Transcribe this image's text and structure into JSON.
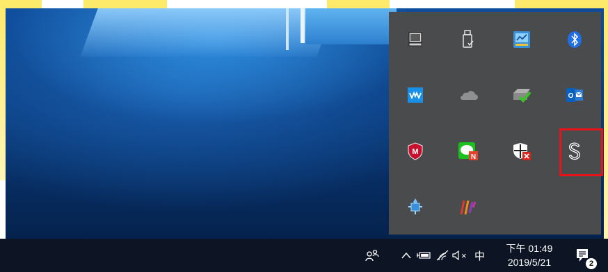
{
  "tray_icons": [
    {
      "name": "display-icon",
      "label": "Display"
    },
    {
      "name": "usb-drive-icon",
      "label": "USB"
    },
    {
      "name": "network-monitor-icon",
      "label": "Network"
    },
    {
      "name": "bluetooth-icon",
      "label": "Bluetooth"
    },
    {
      "name": "waves-audio-icon",
      "label": "Waves"
    },
    {
      "name": "onedrive-icon",
      "label": "OneDrive"
    },
    {
      "name": "safely-remove-hardware-icon",
      "label": "Hardware"
    },
    {
      "name": "outlook-icon",
      "label": "Outlook"
    },
    {
      "name": "mcafee-icon",
      "label": "McAfee"
    },
    {
      "name": "line-icon",
      "label": "LINE"
    },
    {
      "name": "windows-security-icon",
      "label": "Security"
    },
    {
      "name": "s-app-icon",
      "label": "S"
    },
    {
      "name": "intel-graphics-icon",
      "label": "Intel"
    },
    {
      "name": "stripes-app-icon",
      "label": "App"
    }
  ],
  "taskbar": {
    "ime_label": "中",
    "mute_symbol": "×",
    "clock_time": "下午 01:49",
    "clock_date": "2019/5/21",
    "notification_count": "2"
  },
  "colors": {
    "highlight": "#e8121b",
    "popup_bg": "#4a4b4d",
    "taskbar_bg": "#0d1524"
  }
}
